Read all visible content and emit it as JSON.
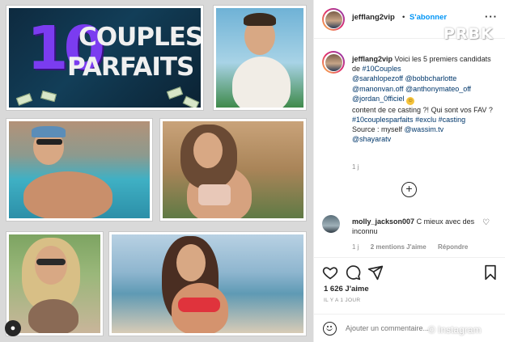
{
  "collage": {
    "logo_number": "10",
    "logo_line1": "COUPLES",
    "logo_line2": "PARFAITS"
  },
  "post": {
    "username": "jefflang2vip",
    "separator": "•",
    "follow_label": "S'abonner",
    "more_icon": "more-horizontal-icon"
  },
  "caption": {
    "username": "jefflang2vip",
    "intro": "Voici les 5 premiers candidats de",
    "hashtag1": "#10Couples",
    "mentions": [
      "@sarahlopezoff",
      "@bobbcharlotte",
      "@manonvan.off",
      "@anthonymateo_off",
      "@jordan_0fficiel"
    ],
    "question": "content de ce casting ?! Qui sont vos FAV ?",
    "hashtags": [
      "#10couplesparfaits",
      "#exclu",
      "#casting"
    ],
    "source_label": "Source : myself",
    "source_mention": "@wassim.tv",
    "last_mention": "@shayaratv",
    "time": "1 j"
  },
  "comment": {
    "username": "molly_jackson007",
    "text": "C mieux avec des inconnu",
    "time": "1 j",
    "likes": "2 mentions J'aime",
    "reply": "Répondre"
  },
  "actions": {
    "like_icon": "heart-icon",
    "comment_icon": "comment-icon",
    "share_icon": "share-icon",
    "save_icon": "bookmark-icon",
    "likes_count": "1 626 J'aime",
    "post_date": "IL Y A 1 JOUR"
  },
  "add_comment": {
    "placeholder": "Ajouter un commentaire..."
  },
  "watermarks": {
    "top": "PRBK",
    "bottom": "© Instagram"
  }
}
